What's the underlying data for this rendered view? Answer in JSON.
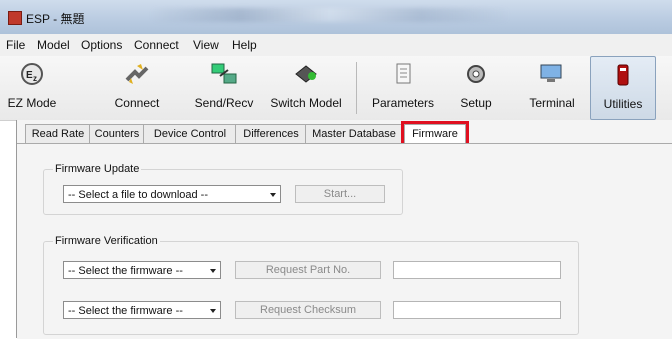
{
  "window": {
    "title": "ESP - 無題"
  },
  "menu": [
    "File",
    "Model",
    "Options",
    "Connect",
    "View",
    "Help"
  ],
  "toolbar": {
    "ez_mode": "EZ Mode",
    "connect": "Connect",
    "send_recv": "Send/Recv",
    "switch_model": "Switch Model",
    "parameters": "Parameters",
    "setup": "Setup",
    "terminal": "Terminal",
    "utilities": "Utilities"
  },
  "tabs": [
    "Read Rate",
    "Counters",
    "Device Control",
    "Differences",
    "Master Database",
    "Firmware"
  ],
  "selected_tab": "Firmware",
  "highlight_color": "#e01020",
  "firmware_update": {
    "title": "Firmware Update",
    "file_select": "-- Select a file to download --",
    "start": "Start..."
  },
  "firmware_verification": {
    "title": "Firmware Verification",
    "select1": "-- Select the firmware --",
    "request_part": "Request Part No.",
    "select2": "-- Select the firmware --",
    "request_checksum": "Request Checksum"
  }
}
